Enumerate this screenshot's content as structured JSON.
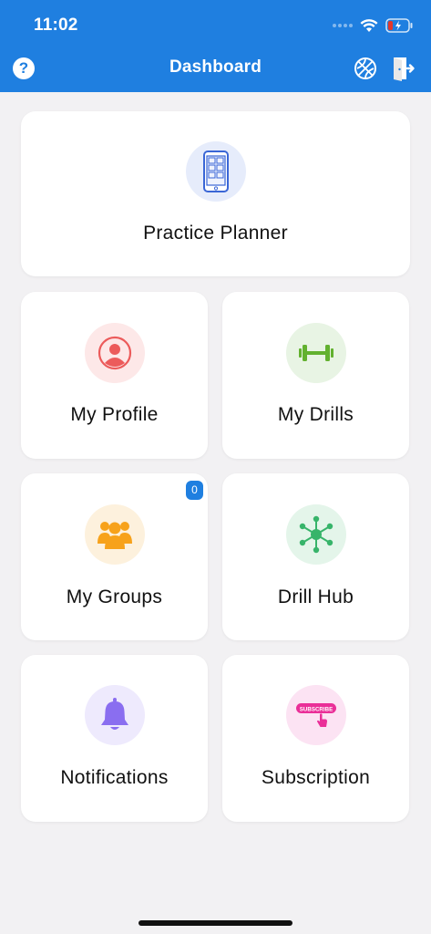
{
  "status_bar": {
    "time": "11:02"
  },
  "header": {
    "title": "Dashboard",
    "help_label": "?",
    "color": "#1f7fe0"
  },
  "cards": {
    "practice_planner": {
      "label": "Practice Planner",
      "icon": "phone-app-icon",
      "circle_color": "#e6ecfb"
    },
    "my_profile": {
      "label": "My Profile",
      "icon": "user-profile-icon",
      "circle_color": "#fde8e8"
    },
    "my_drills": {
      "label": "My Drills",
      "icon": "dumbbell-icon",
      "circle_color": "#e8f4e4"
    },
    "my_groups": {
      "label": "My Groups",
      "icon": "group-icon",
      "circle_color": "#fdf1dd",
      "badge": "0"
    },
    "drill_hub": {
      "label": "Drill Hub",
      "icon": "hub-network-icon",
      "circle_color": "#e4f5ea"
    },
    "notifications": {
      "label": "Notifications",
      "icon": "bell-icon",
      "circle_color": "#eeeafd"
    },
    "subscription": {
      "label": "Subscription",
      "icon": "subscribe-icon",
      "circle_color": "#fce3f3",
      "icon_text": "SUBSCRIBE"
    }
  }
}
